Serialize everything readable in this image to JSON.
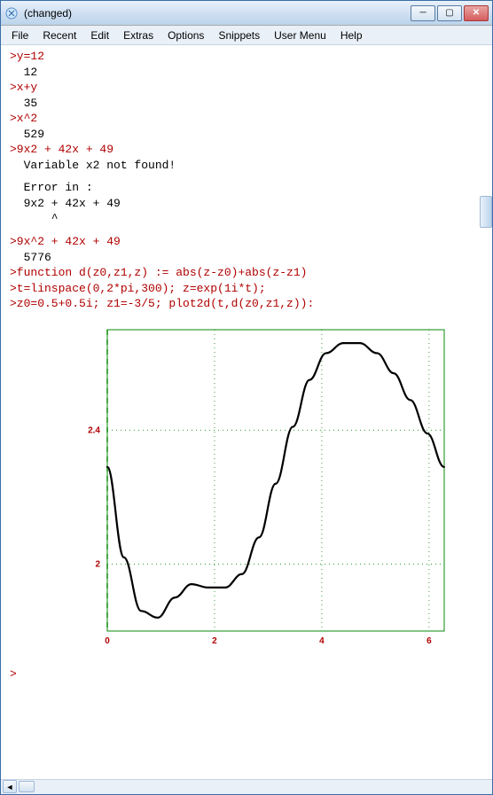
{
  "window": {
    "title": "(changed)"
  },
  "menu": {
    "items": [
      "File",
      "Recent",
      "Edit",
      "Extras",
      "Options",
      "Snippets",
      "User Menu",
      "Help"
    ]
  },
  "session": {
    "lines": [
      {
        "type": "input",
        "text": ">y=12"
      },
      {
        "type": "output",
        "text": "  12"
      },
      {
        "type": "input",
        "text": ">x+y"
      },
      {
        "type": "output",
        "text": "  35"
      },
      {
        "type": "input",
        "text": ">x^2"
      },
      {
        "type": "output",
        "text": "  529"
      },
      {
        "type": "input",
        "text": ">9x2 + 42x + 49"
      },
      {
        "type": "output",
        "text": "  Variable x2 not found!"
      },
      {
        "type": "spacer",
        "text": ""
      },
      {
        "type": "output",
        "text": "  Error in :"
      },
      {
        "type": "output",
        "text": "  9x2 + 42x + 49"
      },
      {
        "type": "output",
        "text": "      ^"
      },
      {
        "type": "spacer",
        "text": ""
      },
      {
        "type": "input",
        "text": ">9x^2 + 42x + 49"
      },
      {
        "type": "output",
        "text": "  5776"
      },
      {
        "type": "input",
        "text": ">function d(z0,z1,z) := abs(z-z0)+abs(z-z1)"
      },
      {
        "type": "input",
        "text": ">t=linspace(0,2*pi,300); z=exp(1i*t);"
      },
      {
        "type": "input",
        "text": ">z0=0.5+0.5i; z1=-3/5; plot2d(t,d(z0,z1,z)):"
      }
    ],
    "prompt": ">"
  },
  "chart_data": {
    "type": "line",
    "title": "",
    "xlabel": "",
    "ylabel": "",
    "xlim": [
      0,
      6.283
    ],
    "ylim": [
      1.8,
      2.7
    ],
    "xticks": [
      0,
      2,
      4,
      6
    ],
    "yticks": [
      2,
      2.4
    ],
    "grid": "dotted",
    "accent": "#0a8a0a",
    "zero_line": {
      "x": 0,
      "style": "dashed"
    },
    "x": [
      0.0,
      0.31,
      0.63,
      0.94,
      1.26,
      1.57,
      1.88,
      2.2,
      2.51,
      2.83,
      3.14,
      3.46,
      3.77,
      4.08,
      4.4,
      4.71,
      5.03,
      5.34,
      5.65,
      5.97,
      6.28
    ],
    "y": [
      2.29,
      2.02,
      1.86,
      1.84,
      1.9,
      1.94,
      1.93,
      1.93,
      1.97,
      2.08,
      2.24,
      2.41,
      2.55,
      2.63,
      2.66,
      2.66,
      2.63,
      2.57,
      2.49,
      2.39,
      2.29
    ]
  }
}
